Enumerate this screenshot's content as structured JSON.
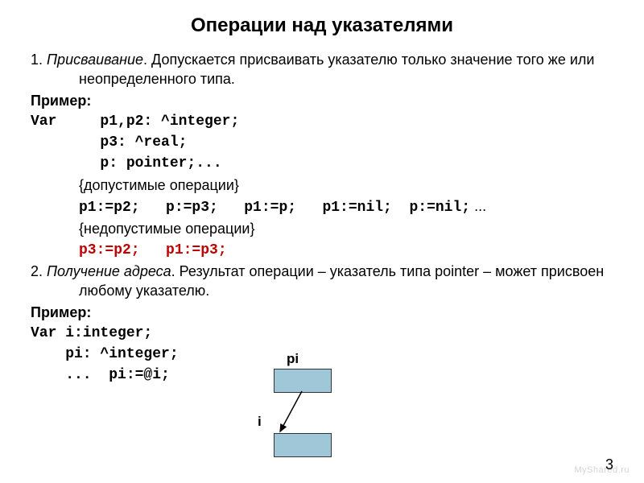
{
  "title": "Операции над указателями",
  "sec1_lead": "1. ",
  "sec1_head": "Присваивание",
  "sec1_rest": ". Допускается присваивать указателю только значение того же или неопределенного типа.",
  "example_label": "Пример:",
  "code_var": "Var     p1,p2: ^integer;",
  "code_p3": "        p3: ^real;",
  "code_p": "        p: pointer;...",
  "allowed_label": "{допустимые операции}",
  "allowed_code": "p1:=p2;   p:=p3;   p1:=p;   p1:=nil;  p:=nil;",
  "allowed_tail": " ...",
  "disallowed_label": "{недопустимые операции}",
  "disallowed_code": "p3:=p2;   p1:=p3;",
  "sec2_lead": "2. ",
  "sec2_head": "Получение адреса",
  "sec2_rest": ". Результат операции – указатель типа pointer – может присвоен любому указателю.",
  "code2_var": "Var i:integer;",
  "code2_pi": "    pi: ^integer;",
  "code2_asn": "    ...  pi:=@i;",
  "diagram": {
    "pi": "pi",
    "i": "i"
  },
  "page_number": "3",
  "watermark": "MyShared.ru"
}
